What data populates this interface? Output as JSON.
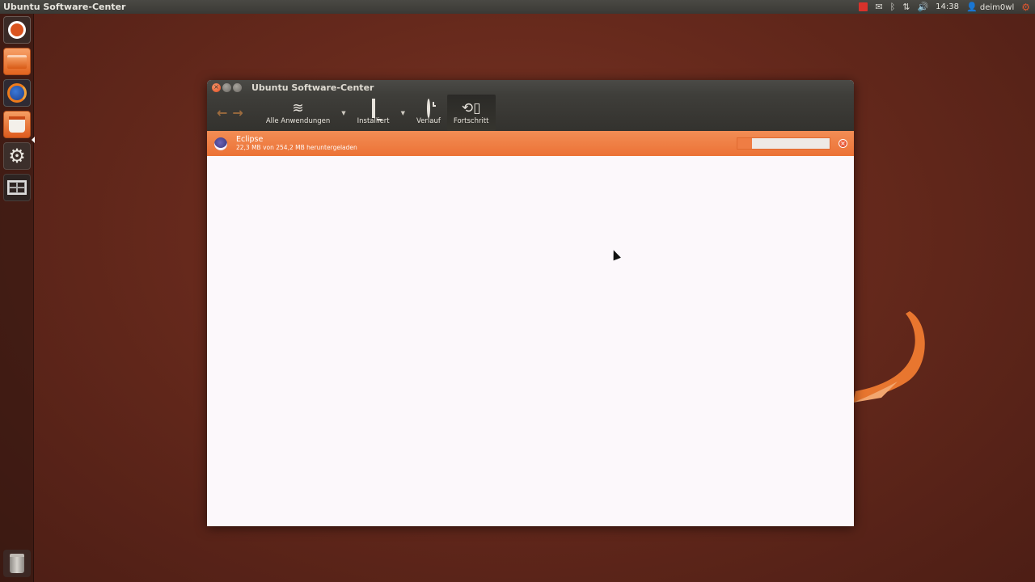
{
  "top_panel": {
    "app_title": "Ubuntu Software-Center",
    "time": "14:38",
    "user": "deim0wl",
    "icons": [
      "indicator-red-icon",
      "mail-icon",
      "bluetooth-icon",
      "network-icon",
      "volume-icon",
      "user-icon",
      "session-gear-icon"
    ]
  },
  "launcher": {
    "items": [
      "dash-home-icon",
      "files-icon",
      "firefox-icon",
      "software-center-icon",
      "system-settings-icon",
      "workspace-switcher-icon",
      "trash-icon"
    ]
  },
  "window": {
    "title": "Ubuntu Software-Center",
    "toolbar": {
      "all_apps": "Alle Anwendungen",
      "installed": "Installiert",
      "history": "Verlauf",
      "progress": "Fortschritt"
    },
    "download": {
      "name": "Eclipse",
      "status": "22,3 MB von 254,2 MB heruntergeladen",
      "progress": 0.16
    }
  },
  "colors": {
    "accent": "#ec7235",
    "desktop": "#66291c",
    "toolbar": "#3a3935"
  }
}
